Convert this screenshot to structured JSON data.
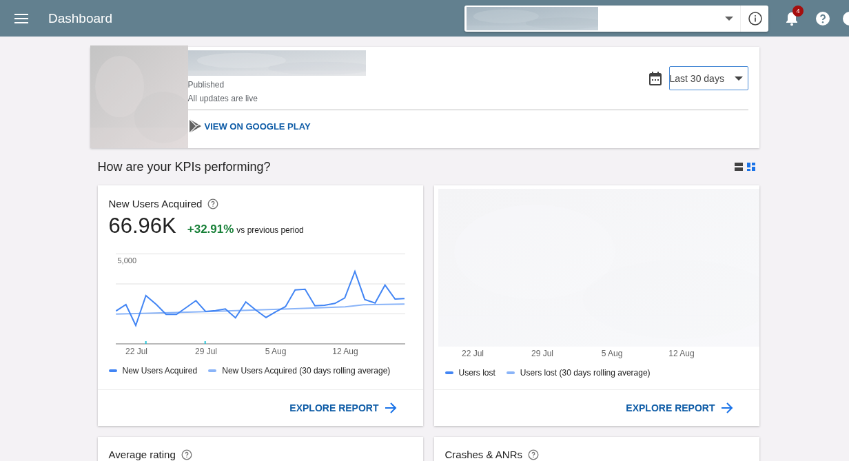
{
  "topbar": {
    "title": "Dashboard",
    "notification_count": "4"
  },
  "app_header": {
    "status": "Published",
    "detail": "All updates are live",
    "store_link": "VIEW ON GOOGLE PLAY",
    "date_range": "Last 30 days"
  },
  "kpi_section": {
    "title": "How are your KPIs performing?",
    "view_modes": [
      {
        "kind": "list",
        "selected": false
      },
      {
        "kind": "grid",
        "selected": true
      }
    ]
  },
  "kpi_cards": [
    {
      "kind": "chart",
      "title": "New Users Acquired",
      "value": "66.96K",
      "change": "+32.91%",
      "change_note": "vs previous period",
      "y_label": "5,000",
      "x_labels": [
        "22 Jul",
        "29 Jul",
        "5 Aug",
        "12 Aug"
      ],
      "legend": [
        {
          "label": "New Users Acquired",
          "color": "#4285f4"
        },
        {
          "label": "New Users Acquired (30 days rolling average)",
          "color": "#8ab4f8"
        }
      ],
      "action": "EXPLORE REPORT"
    },
    {
      "kind": "obscured",
      "x_labels": [
        "22 Jul",
        "29 Jul",
        "5 Aug",
        "12 Aug"
      ],
      "legend": [
        {
          "label": "Users lost",
          "color": "#4285f4"
        },
        {
          "label": "Users lost (30 days rolling average)",
          "color": "#8ab4f8"
        }
      ],
      "action": "EXPLORE REPORT"
    }
  ],
  "bottom_cards": [
    {
      "title": "Average rating"
    },
    {
      "title": "Crashes & ANRs"
    }
  ]
}
